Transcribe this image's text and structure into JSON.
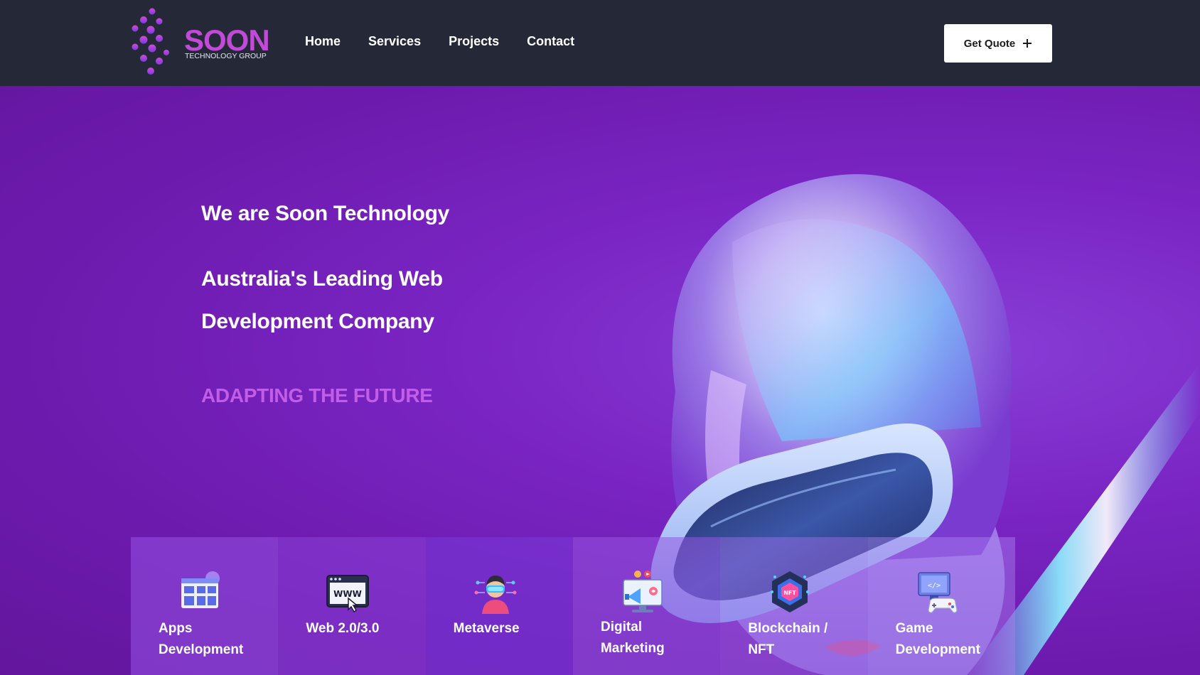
{
  "logo": {
    "name": "SOON",
    "subtitle": "TECHNOLOGY GROUP",
    "icon": "dot-grid-logo-icon",
    "color": "#c04bd6"
  },
  "nav": {
    "items": [
      {
        "label": "Home"
      },
      {
        "label": "Services"
      },
      {
        "label": "Projects"
      },
      {
        "label": "Contact"
      }
    ]
  },
  "header": {
    "quote_label": "Get Quote",
    "quote_icon": "plus-icon"
  },
  "hero": {
    "intro": "We are Soon Technology",
    "headline_line1": "Australia's Leading Web",
    "headline_line2": "Development Company",
    "tagline": "ADAPTING THE FUTURE",
    "tagline_color": "#c25ee6"
  },
  "services": [
    {
      "label_line1": "Apps",
      "label_line2": "Development",
      "icon": "app-grid-icon"
    },
    {
      "label_line1": "Web 2.0/3.0",
      "label_line2": "",
      "icon": "www-browser-icon"
    },
    {
      "label_line1": "Metaverse",
      "label_line2": "",
      "icon": "vr-headset-person-icon"
    },
    {
      "label_line1": "Digital",
      "label_line2": "Marketing",
      "icon": "marketing-monitor-icon"
    },
    {
      "label_line1": "Blockchain /",
      "label_line2": "NFT",
      "icon": "nft-hexagon-icon"
    },
    {
      "label_line1": "Game",
      "label_line2": "Development",
      "icon": "game-controller-icon"
    }
  ],
  "colors": {
    "header_bg": "#252836",
    "hero_bg": "#7a25c4",
    "accent": "#c04bd6"
  }
}
